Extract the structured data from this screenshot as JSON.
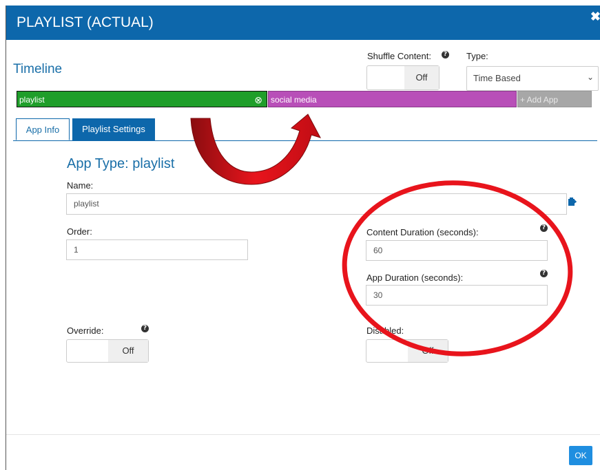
{
  "dialog": {
    "title": "PLAYLIST (ACTUAL)",
    "close_glyph": "✖"
  },
  "timeline": {
    "label": "Timeline"
  },
  "shuffle": {
    "label": "Shuffle Content:",
    "value": "Off"
  },
  "type": {
    "label": "Type:",
    "selected": "Time Based"
  },
  "timeline_bar": {
    "apps": [
      {
        "label": "playlist",
        "color": "#1f9e2a",
        "remove_glyph": "⊗"
      },
      {
        "label": "social media",
        "color": "#b84fb8"
      }
    ],
    "add_app_label": "+ Add App",
    "add_app_color": "#a7a7a7"
  },
  "tabs": {
    "app_info": "App Info",
    "playlist_settings": "Playlist Settings"
  },
  "form": {
    "app_type_heading": "App Type: playlist",
    "name": {
      "label": "Name:",
      "value": "playlist"
    },
    "order": {
      "label": "Order:",
      "value": "1"
    },
    "content_duration": {
      "label": "Content Duration (seconds):",
      "value": "60"
    },
    "app_duration": {
      "label": "App Duration (seconds):",
      "value": "30"
    },
    "override": {
      "label": "Override:",
      "value": "Off"
    },
    "disabled": {
      "label": "Disabled:",
      "value": "Off"
    }
  },
  "footer": {
    "ok_label": "OK"
  },
  "colors": {
    "primary": "#0d67ab",
    "annotation": "#e8141c"
  }
}
